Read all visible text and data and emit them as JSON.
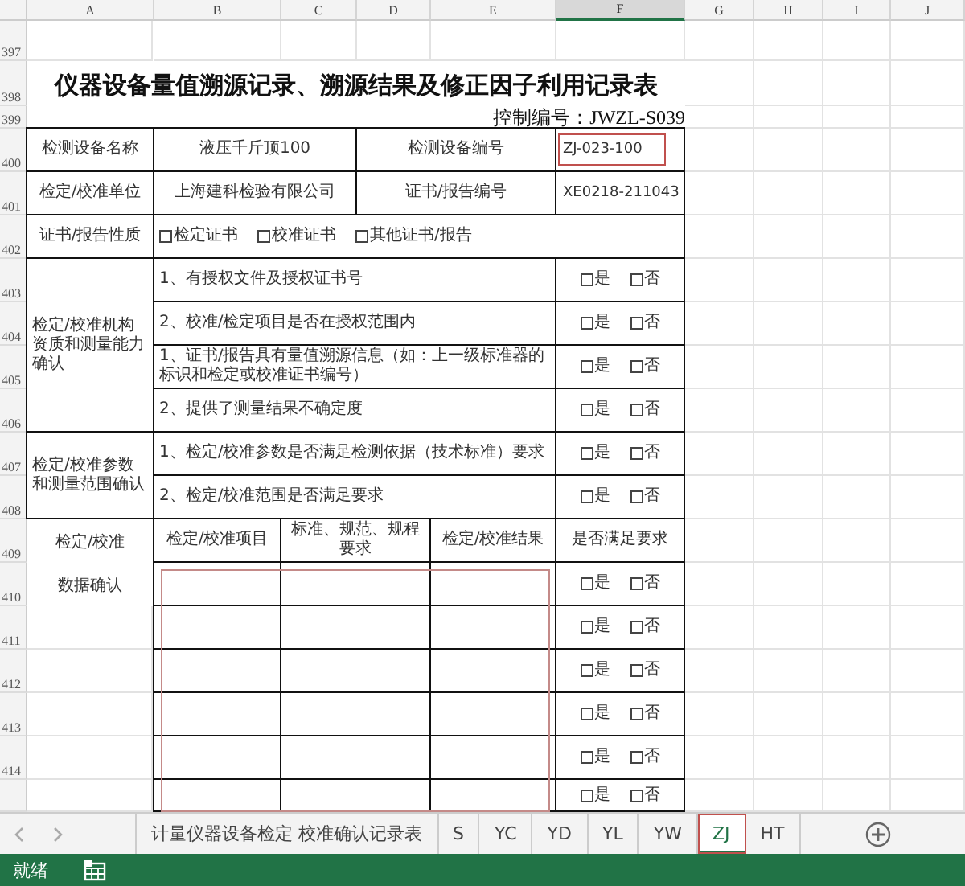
{
  "column_headers": [
    {
      "label": "A",
      "selected": false
    },
    {
      "label": "B",
      "selected": false
    },
    {
      "label": "C",
      "selected": false
    },
    {
      "label": "D",
      "selected": false
    },
    {
      "label": "E",
      "selected": false
    },
    {
      "label": "F",
      "selected": true
    },
    {
      "label": "G",
      "selected": false
    },
    {
      "label": "H",
      "selected": false
    },
    {
      "label": "I",
      "selected": false
    },
    {
      "label": "J",
      "selected": false
    }
  ],
  "row_numbers": [
    "397",
    "398",
    "399",
    "400",
    "401",
    "402",
    "403",
    "404",
    "405",
    "406",
    "407",
    "408",
    "409",
    "410",
    "411",
    "412",
    "413",
    "414"
  ],
  "title": "仪器设备量值溯源记录、溯源结果及修正因子利用记录表",
  "control_number": "控制编号：JWZL-S039",
  "info_rows": [
    {
      "label": "检测设备名称",
      "value": "液压千斤顶100",
      "label_2": "检测设备编号",
      "value_2": "ZJ-023-100",
      "highlighted": true
    },
    {
      "label": "检定/校准单位",
      "value": "上海建科检验有限公司",
      "label_2": "证书/报告编号",
      "value_2": "XE0218-211043",
      "highlighted": false
    }
  ],
  "certificate_type": {
    "label": "证书/报告性质",
    "options": [
      {
        "text": "检定证书",
        "checked": false
      },
      {
        "text": "校准证书",
        "checked": false
      },
      {
        "text": "其他证书/报告",
        "checked": false
      }
    ]
  },
  "sections": [
    {
      "label": "检定/校准机构资质和测量能力确认",
      "items": [
        {
          "text": "1、有授权文件及授权证书号",
          "yes": "是",
          "no": "否",
          "yes_checked": false,
          "no_checked": false
        },
        {
          "text": "2、校准/检定项目是否在授权范围内",
          "yes": "是",
          "no": "否",
          "yes_checked": false,
          "no_checked": false
        },
        {
          "text": "1、证书/报告具有量值溯源信息（如：上一级标准器的标识和检定或校准证书编号）",
          "yes": "是",
          "no": "否",
          "yes_checked": false,
          "no_checked": false
        },
        {
          "text": "2、提供了测量结果不确定度",
          "yes": "是",
          "no": "否",
          "yes_checked": false,
          "no_checked": false
        }
      ]
    },
    {
      "label": "检定/校准参数和测量范围确认",
      "items": [
        {
          "text": "1、检定/校准参数是否满足检测依据（技术标准）要求",
          "yes": "是",
          "no": "否",
          "yes_checked": false,
          "no_checked": false
        },
        {
          "text": "2、检定/校准范围是否满足要求",
          "yes": "是",
          "no": "否",
          "yes_checked": false,
          "no_checked": false
        }
      ]
    }
  ],
  "data_check": {
    "label": "检定/校准",
    "label_2": "数据确认",
    "columns": [
      "检定/校准项目",
      "标准、规范、规程要求",
      "检定/校准结果",
      "是否满足要求"
    ],
    "highlighted": true,
    "rows": [
      {
        "yes": "是",
        "no": "否",
        "yes_checked": false,
        "no_checked": false
      },
      {
        "yes": "是",
        "no": "否",
        "yes_checked": false,
        "no_checked": false
      },
      {
        "yes": "是",
        "no": "否",
        "yes_checked": false,
        "no_checked": false
      },
      {
        "yes": "是",
        "no": "否",
        "yes_checked": false,
        "no_checked": false
      },
      {
        "yes": "是",
        "no": "否",
        "yes_checked": false,
        "no_checked": false
      },
      {
        "yes": "是",
        "no": "否",
        "yes_checked": false,
        "no_checked": false
      }
    ]
  },
  "sheet_tabs": [
    {
      "label": "计量仪器设备检定 校准确认记录表",
      "selected": false,
      "highlighted": false
    },
    {
      "label": "S",
      "selected": false,
      "highlighted": false
    },
    {
      "label": "YC",
      "selected": false,
      "highlighted": false
    },
    {
      "label": "YD",
      "selected": false,
      "highlighted": false
    },
    {
      "label": "YL",
      "selected": false,
      "highlighted": false
    },
    {
      "label": "YW",
      "selected": false,
      "highlighted": false
    },
    {
      "label": "ZJ",
      "selected": true,
      "highlighted": true
    },
    {
      "label": "HT",
      "selected": false,
      "highlighted": false
    }
  ],
  "status_bar": {
    "text": "就绪"
  }
}
